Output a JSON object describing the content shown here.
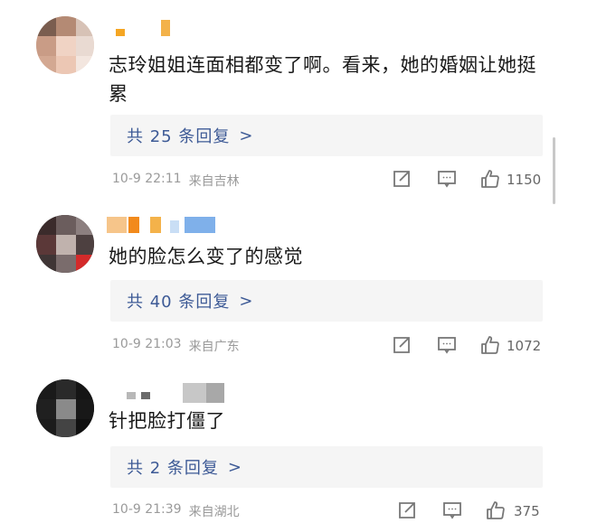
{
  "comments": [
    {
      "text": "志玲姐姐连面相都变了啊。看来，她的婚姻让她挺累",
      "replies": "共 25 条回复",
      "date": "10-9 22:11",
      "location": "来自吉林",
      "likes": "1150"
    },
    {
      "text": "她的脸怎么变了的感觉",
      "replies": "共 40 条回复",
      "date": "10-9 21:03",
      "location": "来自广东",
      "likes": "1072"
    },
    {
      "text": "针把脸打僵了",
      "replies": "共 2 条回复",
      "date": "10-9 21:39",
      "location": "来自湖北",
      "likes": "375"
    }
  ],
  "icons": {
    "reply_chevron": ">",
    "share": "share-icon",
    "comment": "comment-icon",
    "like": "thumbs-up-icon"
  },
  "colors": {
    "link": "#3d5a96",
    "meta": "#9a9a9a",
    "reply_bg": "#f5f5f5"
  }
}
